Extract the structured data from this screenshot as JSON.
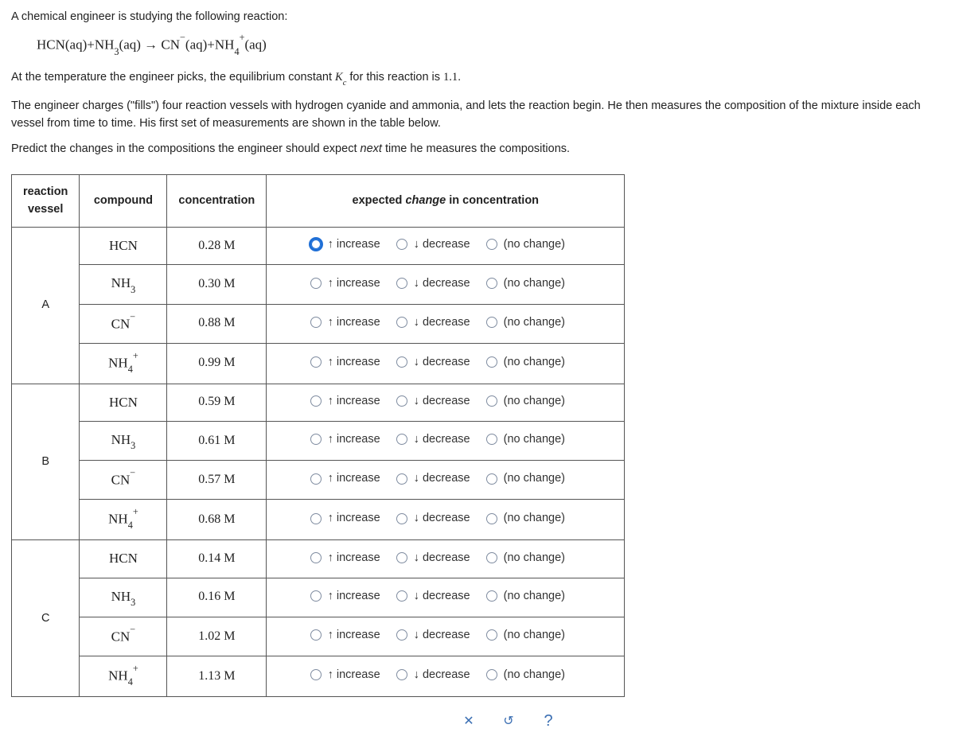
{
  "intro": "A chemical engineer is studying the following reaction:",
  "equation_html": "HCN(aq)+NH<span class='sub'>3</span>(aq) → CN<span class='sup'>−</span>(aq)+NH<span class='sub'>4</span><span class='sup'>+</span>(aq)",
  "para_kc_pre": "At the temperature the engineer picks, the equilibrium constant ",
  "para_kc_sym": "K",
  "para_kc_sub": "c",
  "para_kc_post": " for this reaction is ",
  "para_kc_val": "1.1",
  "para_kc_end": ".",
  "para2": "The engineer charges (\"fills\") four reaction vessels with hydrogen cyanide and ammonia, and lets the reaction begin. He then measures the composition of the mixture inside each vessel from time to time. His first set of measurements are shown in the table below.",
  "para3_pre": "Predict the changes in the compositions the engineer should expect ",
  "para3_em": "next",
  "para3_post": " time he measures the compositions.",
  "headers": {
    "vessel": "reaction vessel",
    "compound": "compound",
    "conc": "concentration",
    "expected_pre": "expected ",
    "expected_em": "change",
    "expected_post": " in concentration"
  },
  "options": {
    "increase": "↑ increase",
    "decrease": "↓ decrease",
    "nochange": "(no change)"
  },
  "rows": [
    {
      "vessel": "A",
      "compound_html": "HCN",
      "conc": "0.28 M",
      "focused": true
    },
    {
      "vessel": "A",
      "compound_html": "NH<span class='sub'>3</span>",
      "conc": "0.30 M",
      "focused": false
    },
    {
      "vessel": "A",
      "compound_html": "CN<span class='sup'>−</span>",
      "conc": "0.88 M",
      "focused": false
    },
    {
      "vessel": "A",
      "compound_html": "NH<span class='sub'>4</span><span class='sup'>+</span>",
      "conc": "0.99 M",
      "focused": false
    },
    {
      "vessel": "B",
      "compound_html": "HCN",
      "conc": "0.59 M",
      "focused": false
    },
    {
      "vessel": "B",
      "compound_html": "NH<span class='sub'>3</span>",
      "conc": "0.61 M",
      "focused": false
    },
    {
      "vessel": "B",
      "compound_html": "CN<span class='sup'>−</span>",
      "conc": "0.57 M",
      "focused": false
    },
    {
      "vessel": "B",
      "compound_html": "NH<span class='sub'>4</span><span class='sup'>+</span>",
      "conc": "0.68 M",
      "focused": false
    },
    {
      "vessel": "C",
      "compound_html": "HCN",
      "conc": "0.14 M",
      "focused": false
    },
    {
      "vessel": "C",
      "compound_html": "NH<span class='sub'>3</span>",
      "conc": "0.16 M",
      "focused": false
    },
    {
      "vessel": "C",
      "compound_html": "CN<span class='sup'>−</span>",
      "conc": "1.02 M",
      "focused": false
    },
    {
      "vessel": "C",
      "compound_html": "NH<span class='sub'>4</span><span class='sup'>+</span>",
      "conc": "1.13 M",
      "focused": false
    }
  ],
  "controls": {
    "close": "✕",
    "undo": "↺",
    "help": "?"
  }
}
